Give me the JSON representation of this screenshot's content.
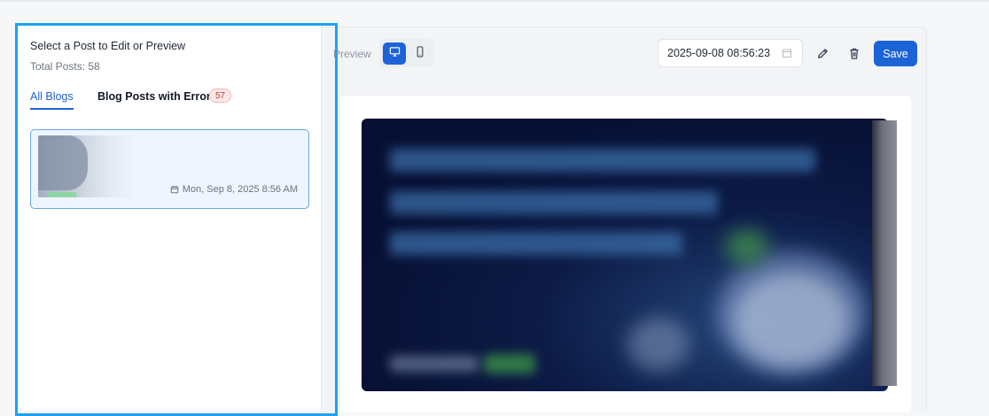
{
  "sidebar": {
    "title": "Select a Post to Edit or Preview",
    "total_posts": "Total Posts: 58",
    "tabs": [
      {
        "label": "All Blogs",
        "active": true
      },
      {
        "label": "Blog Posts with Errors",
        "active": false,
        "badge": "57"
      }
    ],
    "posts": [
      {
        "date": "Mon, Sep 8, 2025 8:56 AM",
        "selected": true
      }
    ]
  },
  "toolbar": {
    "preview_label": "Preview",
    "view_modes": [
      {
        "name": "desktop",
        "icon": "monitor-icon",
        "active": true
      },
      {
        "name": "mobile",
        "icon": "smartphone-icon",
        "active": false
      }
    ],
    "datetime_value": "2025-09-08 08:56:23",
    "save_label": "Save"
  },
  "colors": {
    "accent": "#1d63d8",
    "highlight_frame": "#1ea1f2",
    "error_badge": "#c0392b"
  }
}
